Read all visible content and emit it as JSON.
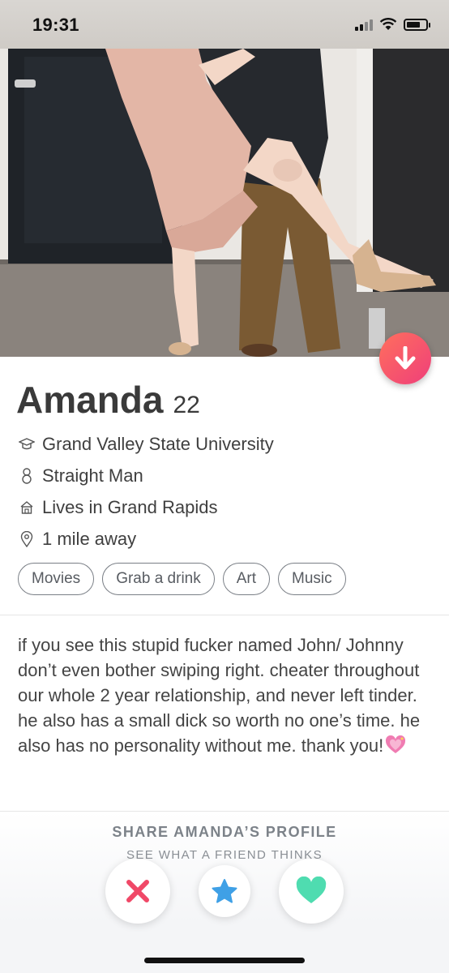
{
  "status_bar": {
    "time": "19:31"
  },
  "profile": {
    "name": "Amanda",
    "age": "22",
    "school": "Grand Valley State University",
    "orientation": "Straight Man",
    "lives_in": "Lives in Grand Rapids",
    "distance": "1 mile away",
    "interests": [
      "Movies",
      "Grab a drink",
      "Art",
      "Music"
    ],
    "bio": "if you see this stupid fucker named John/ Johnny don’t even bother swiping right. cheater throughout our whole 2 year relationship, and never left tinder. he also has a small dick so worth no one’s time. he also has no personality without me. thank you!"
  },
  "share": {
    "title": "SHARE AMANDA’S PROFILE",
    "subtitle": "SEE WHAT A FRIEND THINKS"
  },
  "icons": {
    "collapse": "arrow-down-icon",
    "school": "graduation-cap-icon",
    "orientation": "gender-icon",
    "home": "house-icon",
    "location": "location-pin-icon",
    "bio_emoji": "sparkling-heart-icon",
    "nope": "x-icon",
    "super_like": "star-icon",
    "like": "heart-icon"
  },
  "colors": {
    "accent_gradient_start": "#ff6f5d",
    "accent_gradient_end": "#ef3f7a",
    "nope": "#f04867",
    "super_like": "#3fa0e6",
    "like": "#4fdcb0",
    "chip_border": "#7a7f86"
  }
}
